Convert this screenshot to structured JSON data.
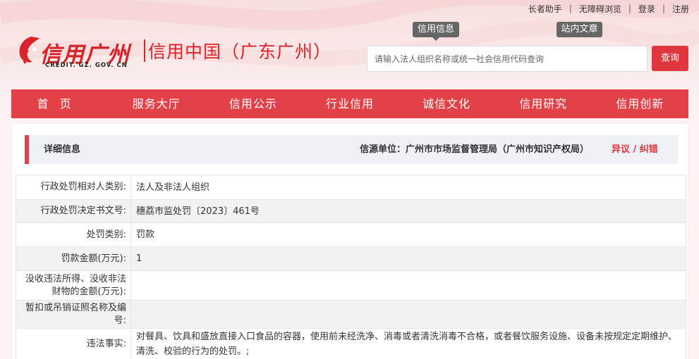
{
  "top_links": [
    "长者助手",
    "无障碍浏览",
    "登录",
    "注册"
  ],
  "logo": {
    "cn_main": "信用广州",
    "cn_sub": "信用中国（广东广州）",
    "en": "CREDIT. GZ. GOV. CN"
  },
  "search": {
    "tabs": [
      "信用信息",
      "站内文章"
    ],
    "placeholder": "请输入法人组织名称或统一社会信用代码查询",
    "button": "查询"
  },
  "nav": [
    "首页",
    "服务大厅",
    "信用公示",
    "行业信用",
    "诚信文化",
    "信用研究",
    "信用创新"
  ],
  "info": {
    "title": "详细信息",
    "source": "信源单位：广州市市场监督管理局（广州市知识产权局）",
    "objection": "异议 / 纠错"
  },
  "rows": [
    {
      "label": "行政处罚相对人类别:",
      "value": "法人及非法人组织"
    },
    {
      "label": "行政处罚决定书文号:",
      "value": "穗荔市监处罚〔2023〕461号"
    },
    {
      "label": "处罚类别:",
      "value": "罚款"
    },
    {
      "label": "罚款金额(万元):",
      "value": "1"
    },
    {
      "label": "没收违法所得、没收非法财物的金额(万元):",
      "value": ""
    },
    {
      "label": "暂扣或吊销证照名称及编号:",
      "value": ""
    },
    {
      "label": "违法事实:",
      "value": "对餐具、饮具和盛放直接入口食品的容器，使用前未经洗净、消毒或者清洗消毒不合格，或者餐饮服务设施、设备未按规定定期维护、清洗、校验的行为的处罚。;"
    }
  ],
  "colors": {
    "accent": "#e24247",
    "button": "#e0363d",
    "brand": "#d8232a"
  }
}
